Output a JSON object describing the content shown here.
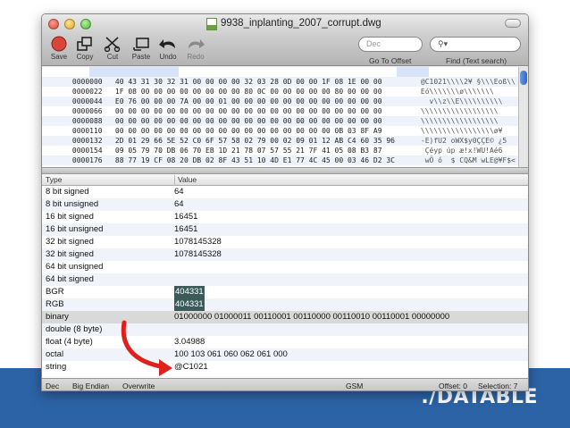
{
  "window": {
    "title": "9938_inplanting_2007_corrupt.dwg"
  },
  "toolbar": {
    "buttons": [
      {
        "label": "Save",
        "icon": "save-icon"
      },
      {
        "label": "Copy",
        "icon": "copy-icon"
      },
      {
        "label": "Cut",
        "icon": "scissors-icon"
      },
      {
        "label": "Paste",
        "icon": "paste-icon"
      },
      {
        "label": "Undo",
        "icon": "undo-icon"
      },
      {
        "label": "Redo",
        "icon": "redo-icon"
      }
    ],
    "offset_search": {
      "placeholder": "Dec",
      "label": "Go To Offset"
    },
    "find_search": {
      "placeholder": "",
      "label": "Find (Text search)"
    }
  },
  "hex": {
    "rows": [
      {
        "offset": "0000000",
        "bytes": "40 43 31 30 32 31 00 00 00 00 32 03 28 0D 00 00 1F 08 1E 00 00",
        "ascii": "@C1021\\\\\\\\2¥ §\\\\\\Eoß\\\\"
      },
      {
        "offset": "0000022",
        "bytes": "1F 08 00 00 00 00 00 00 00 00 80 0C 00 00 00 00 00 80 00 00 00",
        "ascii": "Eó\\\\\\\\\\\\\\ø\\\\\\\\\\\\\\"
      },
      {
        "offset": "0000044",
        "bytes": "E0 76 00 00 00 7A 00 00 01 00 00 00 00 00 00 00 00 00 00 00 00",
        "ascii": "  v\\\\z\\\\E\\\\\\\\\\\\\\\\\\\\"
      },
      {
        "offset": "0000066",
        "bytes": "00 00 00 00 00 00 00 00 00 00 00 00 00 00 00 00 00 00 00 00 00",
        "ascii": "\\\\\\\\\\\\\\\\\\\\\\\\\\\\\\\\\\\\"
      },
      {
        "offset": "0000088",
        "bytes": "00 00 00 00 00 00 00 00 00 00 00 00 00 00 00 00 00 00 00 00 00",
        "ascii": "\\\\\\\\\\\\\\\\\\\\\\\\\\\\\\\\\\\\"
      },
      {
        "offset": "0000110",
        "bytes": "00 00 00 00 00 00 00 00 00 00 00 00 00 00 00 00 00 0B 03 8F A9",
        "ascii": "\\\\\\\\\\\\\\\\\\\\\\\\\\\\\\\\\\ø¥"
      },
      {
        "offset": "0000132",
        "bytes": "2D 01 29 66 5E 52 C0 6F 57 58 02 79 00 02 09 01 12 AB C4 60 35 96",
        "ascii": "-E)fU2 oWX$y0ÇÇE© ¿5"
      },
      {
        "offset": "0000154",
        "bytes": "09 05 79 70 DB 06 70 EB 1D 21 78 07 57 55 21 7F 41 05 08 B3 87",
        "ascii": " Çéyp úp æ!x!WU!Aé6"
      },
      {
        "offset": "0000176",
        "bytes": "88 77 19 CF 08 20 DB 02 8F 43 51 10 4D E1 77 4C 45 00 03 46 D2 3C",
        "ascii": " wÖ ó  $ CQ&M wLE@¥F$<"
      }
    ]
  },
  "table": {
    "headers": {
      "type": "Type",
      "value": "Value"
    },
    "rows": [
      {
        "type": "8 bit signed",
        "value": "64"
      },
      {
        "type": "8 bit unsigned",
        "value": "64"
      },
      {
        "type": "16 bit signed",
        "value": "16451"
      },
      {
        "type": "16 bit unsigned",
        "value": "16451"
      },
      {
        "type": "32 bit signed",
        "value": "1078145328"
      },
      {
        "type": "32 bit signed",
        "value": "1078145328"
      },
      {
        "type": "64 bit unsigned",
        "value": ""
      },
      {
        "type": "64 bit signed",
        "value": ""
      },
      {
        "type": "BGR",
        "value": "404331"
      },
      {
        "type": "RGB",
        "value": "404331"
      },
      {
        "type": "binary",
        "value": "01000000 01000011 00110001 00110000 00110010 00110001 00000000"
      },
      {
        "type": "double (8 byte)",
        "value": ""
      },
      {
        "type": "float (4 byte)",
        "value": "3.04988"
      },
      {
        "type": "octal",
        "value": "100 103 061 060 062 061 000"
      },
      {
        "type": "string",
        "value": "@C1021"
      }
    ]
  },
  "status": {
    "base": "Dec",
    "endian": "Big Endian",
    "mode": "Overwrite",
    "encoding": "GSM",
    "offset": "Offset: 0",
    "selection": "Selection: 7"
  },
  "brand": "./DATABLE",
  "colors": {
    "band": "#2c63a6",
    "arrow": "#e0201b",
    "selection": "#b6cef0"
  }
}
